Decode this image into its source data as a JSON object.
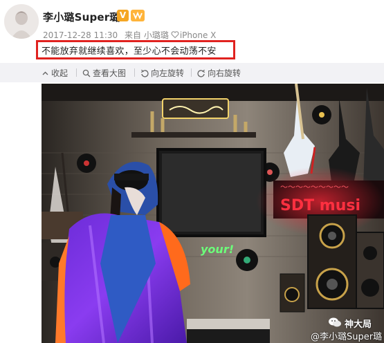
{
  "post": {
    "username": "李小璐Super璐",
    "verified_badge": "V",
    "timestamp": "2017-12-28 11:30",
    "source_prefix": "来自",
    "source_user": "小璐璐",
    "source_device": "iPhone X",
    "content": "不能放弃就继续喜欢，至少心不会动荡不安",
    "highlight_color": "#e0221f"
  },
  "toolbar": {
    "collapse_label": "收起",
    "view_large_label": "查看大图",
    "rotate_left_label": "向左旋转",
    "rotate_right_label": "向右旋转"
  },
  "photo": {
    "neon_sign_text": "SDT musi",
    "neon_small_text": "your!"
  },
  "watermark": {
    "wechat_account": "神大局",
    "weibo_handle": "@李小璐Super璐"
  }
}
